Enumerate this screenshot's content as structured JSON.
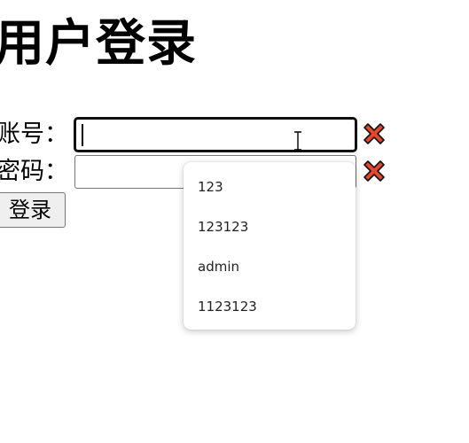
{
  "page": {
    "title": "用户登录"
  },
  "form": {
    "username_label": "账号：",
    "username_value": "",
    "password_label": "密码：",
    "password_value": "",
    "submit_label": "登录"
  },
  "autocomplete": {
    "suggestions": [
      "123",
      "123123",
      "admin",
      "1123123"
    ]
  },
  "icons": {
    "clear": "close-x-icon",
    "clear_color": "#e8462c",
    "clear_outline": "#111111"
  }
}
